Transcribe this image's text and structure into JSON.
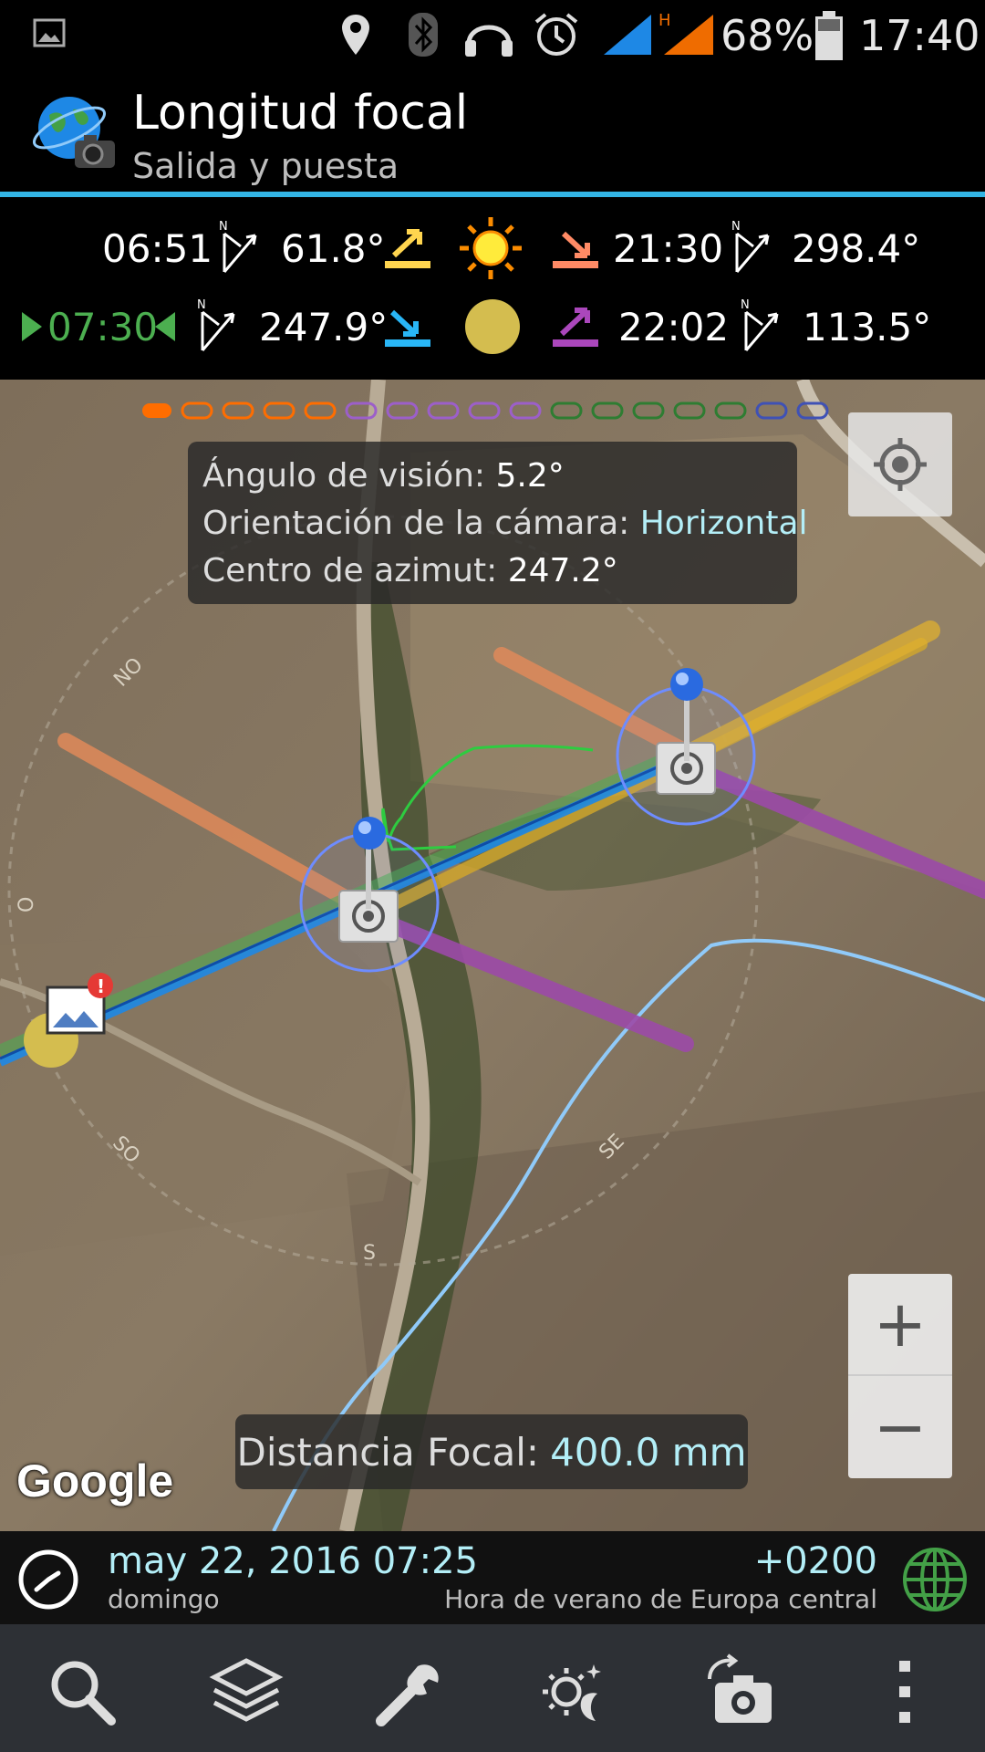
{
  "status_bar": {
    "battery_percent": "68%",
    "time": "17:40",
    "icons": [
      "image-notification-icon",
      "location-icon",
      "bluetooth-icon",
      "headset-icon",
      "alarm-icon",
      "signal-icon",
      "signal-h-icon",
      "battery-icon"
    ]
  },
  "app_bar": {
    "title": "Longitud focal",
    "subtitle": "Salida y puesta"
  },
  "sun": {
    "rise_time": "06:51",
    "rise_azimuth": "61.8°",
    "set_time": "21:30",
    "set_azimuth": "298.4°"
  },
  "moon": {
    "current_time": "07:30",
    "rise_azimuth": "247.9°",
    "set_time": "22:02",
    "set_azimuth": "113.5°"
  },
  "info_box": {
    "view_angle_label": "Ángulo de visión:",
    "view_angle_value": "5.2°",
    "orientation_label": "Orientación de la cámara:",
    "orientation_value": "Horizontal",
    "azimuth_label": "Centro de azimut:",
    "azimuth_value": "247.2°"
  },
  "compass_labels": {
    "nw": "NO",
    "w": "O",
    "sw": "SO",
    "s": "S",
    "se": "SE"
  },
  "focal": {
    "label": "Distancia Focal:",
    "value": "400.0 mm"
  },
  "map": {
    "attribution": "Google",
    "zoom_in": "+",
    "zoom_out": "−"
  },
  "date_bar": {
    "date": "may 22, 2016 07:25",
    "weekday": "domingo",
    "tz_offset": "+0200",
    "tz_name": "Hora de verano de Europa central"
  },
  "colors": {
    "accent": "#33b5e5",
    "sun_rise": "#ffd54f",
    "sun_set": "#ff8a65",
    "moon_rise": "#29b6f6",
    "moon_set": "#ab47bc",
    "current_time": "#4caf50",
    "highlight_text": "#b3eef7"
  },
  "toolbar": {
    "icons": [
      "search-icon",
      "layers-icon",
      "wrench-icon",
      "sun-moon-icon",
      "camera-icon",
      "overflow-menu-icon"
    ]
  }
}
